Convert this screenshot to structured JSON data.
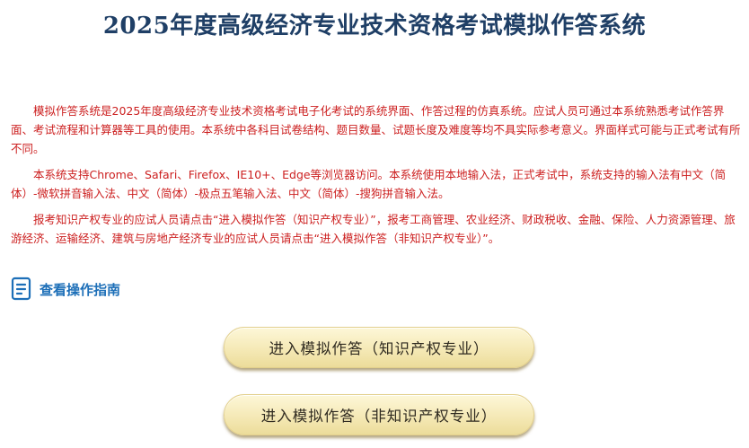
{
  "header": {
    "title": "2025年度高级经济专业技术资格考试模拟作答系统"
  },
  "intro": {
    "paragraphs": [
      "模拟作答系统是2025年度高级经济专业技术资格考试电子化考试的系统界面、作答过程的仿真系统。应试人员可通过本系统熟悉考试作答界面、考试流程和计算器等工具的使用。本系统中各科目试卷结构、题目数量、试题长度及难度等均不具实际参考意义。界面样式可能与正式考试有所不同。",
      "本系统支持Chrome、Safari、Firefox、IE10+、Edge等浏览器访问。本系统使用本地输入法，正式考试中，系统支持的输入法有中文（简体）-微软拼音输入法、中文（简体）-极点五笔输入法、中文（简体）-搜狗拼音输入法。",
      "报考知识产权专业的应试人员请点击“进入模拟作答（知识产权专业）”，报考工商管理、农业经济、财政税收、金融、保险、人力资源管理、旅游经济、运输经济、建筑与房地产经济专业的应试人员请点击“进入模拟作答（非知识产权专业）”。"
    ]
  },
  "guide": {
    "label": "查看操作指南",
    "icon": "document-icon"
  },
  "buttons": {
    "ip": "进入模拟作答（知识产权专业）",
    "non_ip": "进入模拟作答（非知识产权专业）"
  },
  "colors": {
    "title": "#1f3f66",
    "intro_text": "#cc1f1f",
    "link": "#1d6fb8",
    "button_fill": "#f5e9b6"
  }
}
